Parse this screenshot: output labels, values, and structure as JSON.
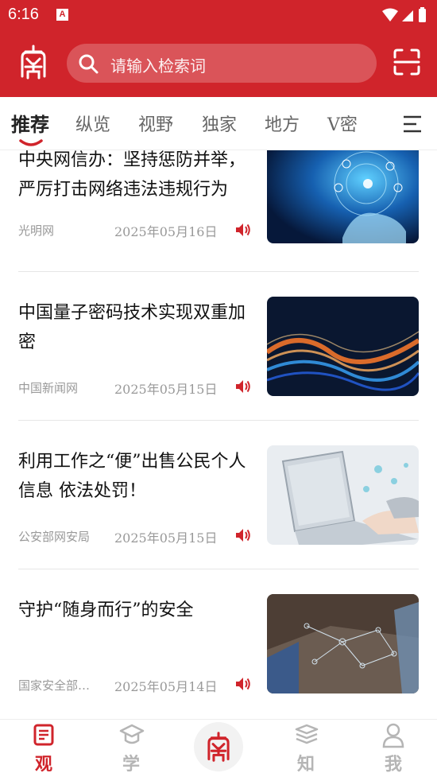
{
  "status": {
    "time": "6:16",
    "badge": "A"
  },
  "header": {
    "search_placeholder": "请输入检索词",
    "logo_icon": "seal-logo-icon",
    "scan_icon": "scan-icon"
  },
  "tabs": [
    {
      "label": "推荐",
      "active": true
    },
    {
      "label": "纵览"
    },
    {
      "label": "视野"
    },
    {
      "label": "独家"
    },
    {
      "label": "地方"
    },
    {
      "label": "V密"
    }
  ],
  "feed": [
    {
      "title": "中央网信办：坚持惩防并举，严厉打击网络违法违规行为",
      "source": "光明网",
      "date": "2025年05月16日"
    },
    {
      "title": "中国量子密码技术实现双重加密",
      "source": "中国新闻网",
      "date": "2025年05月15日"
    },
    {
      "title": "利用工作之“便”出售公民个人信息 依法处罚！",
      "source": "公安部网安局",
      "date": "2025年05月15日"
    },
    {
      "title": "守护“随身而行”的安全",
      "source": "国家安全部…",
      "date": "2025年05月14日"
    }
  ],
  "bottom_nav": [
    {
      "label": "观",
      "icon": "news-icon",
      "active": true
    },
    {
      "label": "学",
      "icon": "graduation-cap-icon"
    },
    {
      "label": "",
      "icon": "seal-logo-icon"
    },
    {
      "label": "知",
      "icon": "books-icon"
    },
    {
      "label": "我",
      "icon": "user-icon"
    }
  ],
  "colors": {
    "brand": "#d0242b",
    "inactive": "#b5b5b5"
  }
}
